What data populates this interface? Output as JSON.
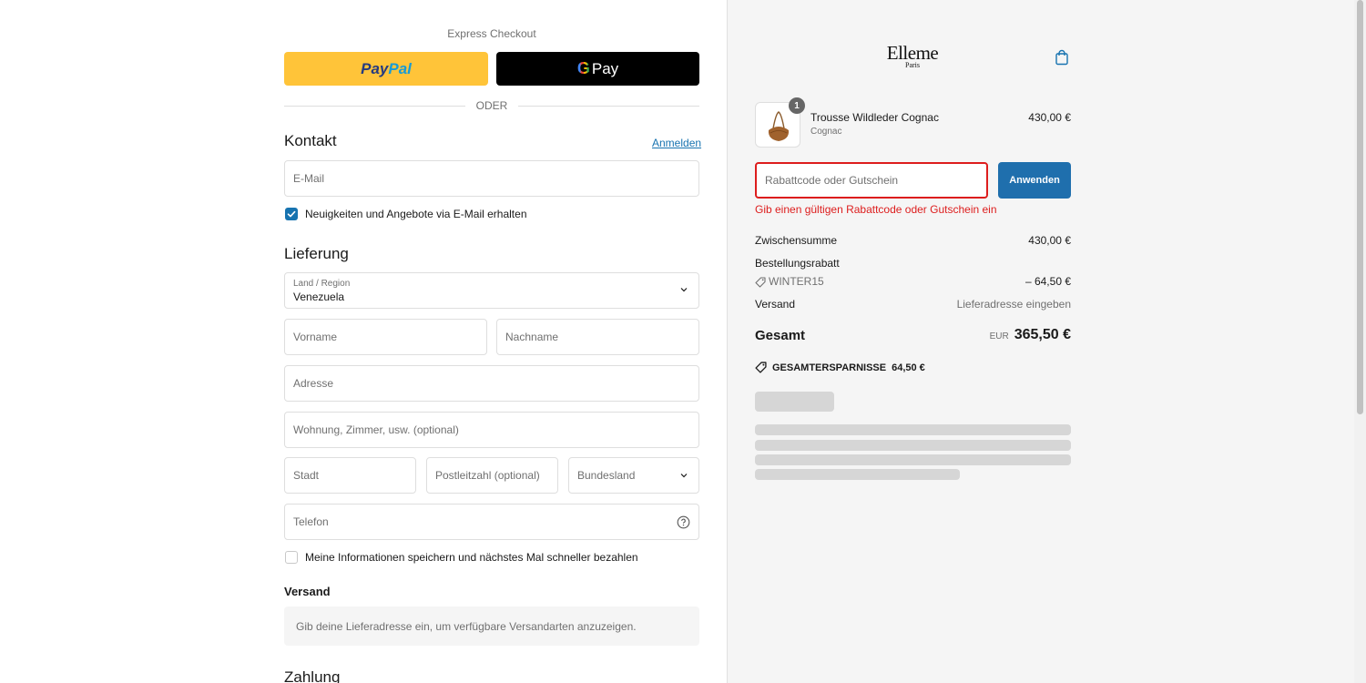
{
  "express": {
    "title": "Express Checkout",
    "paypal_a": "Pay",
    "paypal_b": "Pal",
    "gpay_g": "G",
    "gpay_label": "Pay",
    "separator": "ODER"
  },
  "contact": {
    "heading": "Kontakt",
    "login_link": "Anmelden",
    "email_placeholder": "E-Mail",
    "newsletter_label": "Neuigkeiten und Angebote via E-Mail erhalten",
    "newsletter_checked": true
  },
  "delivery": {
    "heading": "Lieferung",
    "country_label": "Land / Region",
    "country_value": "Venezuela",
    "first_name": "Vorname",
    "last_name": "Nachname",
    "address": "Adresse",
    "apartment": "Wohnung, Zimmer, usw. (optional)",
    "city": "Stadt",
    "zip": "Postleitzahl (optional)",
    "state": "Bundesland",
    "phone": "Telefon",
    "save_info_label": "Meine Informationen speichern und nächstes Mal schneller bezahlen",
    "save_info_checked": false
  },
  "shipping": {
    "heading": "Versand",
    "info": "Gib deine Lieferadresse ein, um verfügbare Versandarten anzuzeigen."
  },
  "payment": {
    "heading": "Zahlung"
  },
  "store": {
    "brand": "Elleme",
    "brand_sub": "Paris"
  },
  "cart": {
    "item": {
      "name": "Trousse Wildleder Cognac",
      "variant": "Cognac",
      "price": "430,00 €",
      "quantity": "1"
    },
    "discount_placeholder": "Rabattcode oder Gutschein",
    "apply_label": "Anwenden",
    "error": "Gib einen gültigen Rabattcode oder Gutschein ein",
    "subtotal_label": "Zwischensumme",
    "subtotal_value": "430,00 €",
    "order_discount_label": "Bestellungsrabatt",
    "discount_code": "WINTER15",
    "discount_value": "– 64,50 €",
    "shipping_label": "Versand",
    "shipping_value": "Lieferadresse eingeben",
    "total_label": "Gesamt",
    "total_currency": "EUR",
    "total_value": "365,50 €",
    "savings_label": "GESAMTERSPARNISSE",
    "savings_value": "64,50 €"
  },
  "colors": {
    "accent": "#1773b0",
    "apply_button": "#1f6fad",
    "error": "#dd1d1d",
    "paypal": "#ffc439"
  }
}
